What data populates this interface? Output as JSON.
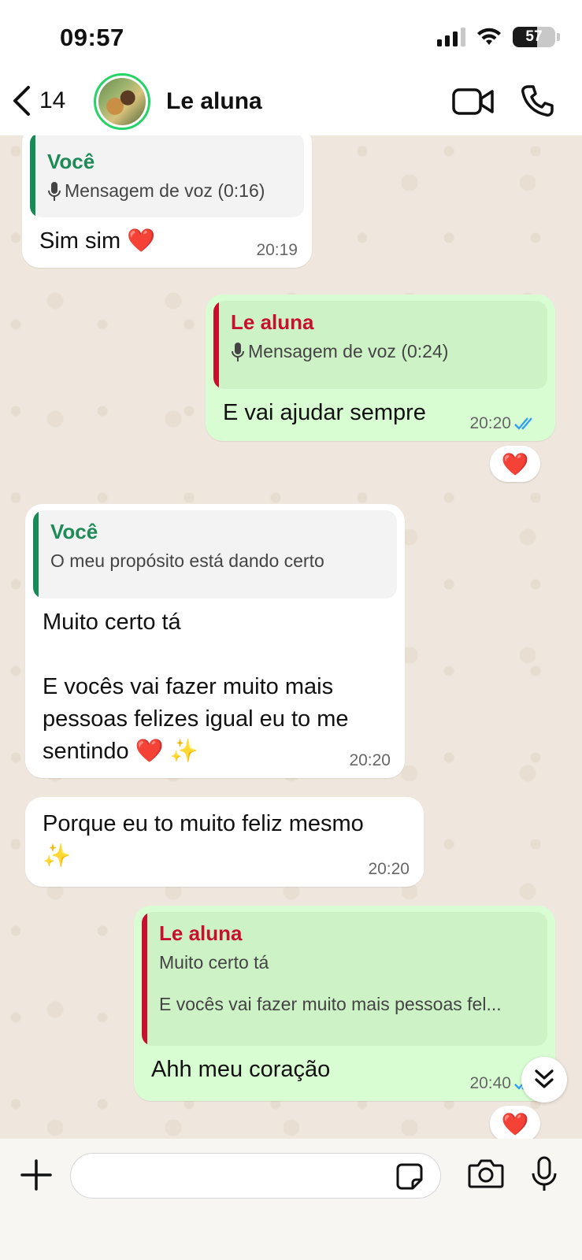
{
  "status_bar": {
    "time": "09:57",
    "battery": "57",
    "battery_level": 0.57
  },
  "header": {
    "back_count": "14",
    "contact_name": "Le aluna"
  },
  "messages": [
    {
      "direction": "in",
      "quote_author": "Você",
      "quote_text": "Mensagem de voz (0:16)",
      "quote_is_voice": true,
      "text": "Sim sim",
      "emoji": "❤️",
      "time": "20:19"
    },
    {
      "direction": "out",
      "quote_author": "Le aluna",
      "quote_text": "Mensagem de voz (0:24)",
      "quote_is_voice": true,
      "text": "E vai ajudar sempre",
      "time": "20:20",
      "read": true,
      "reaction": "❤️"
    },
    {
      "direction": "in",
      "quote_author": "Você",
      "quote_text": "O meu propósito está dando certo",
      "text_line1": "Muito certo tá",
      "text_line2": "E vocês vai fazer muito mais",
      "text_line3": "pessoas felizes igual eu to me",
      "text_line4": "sentindo",
      "emoji1": "❤️",
      "emoji2": "✨",
      "time": "20:20"
    },
    {
      "direction": "in",
      "text": "Porque eu to muito feliz mesmo",
      "emoji": "✨",
      "time": "20:20"
    },
    {
      "direction": "out",
      "quote_author": "Le aluna",
      "quote_text_line1": "Muito certo tá",
      "quote_text_line2": "E vocês vai fazer muito mais pessoas fel...",
      "text": "Ahh meu coração",
      "time": "20:40",
      "read": true,
      "reaction": "❤️"
    }
  ],
  "input": {
    "placeholder": ""
  },
  "colors": {
    "accent_green": "#25d366",
    "outgoing_bubble": "#d9fdd3",
    "quote_green": "#168b57",
    "quote_red": "#c8102e",
    "read_tick": "#34a0f0"
  }
}
